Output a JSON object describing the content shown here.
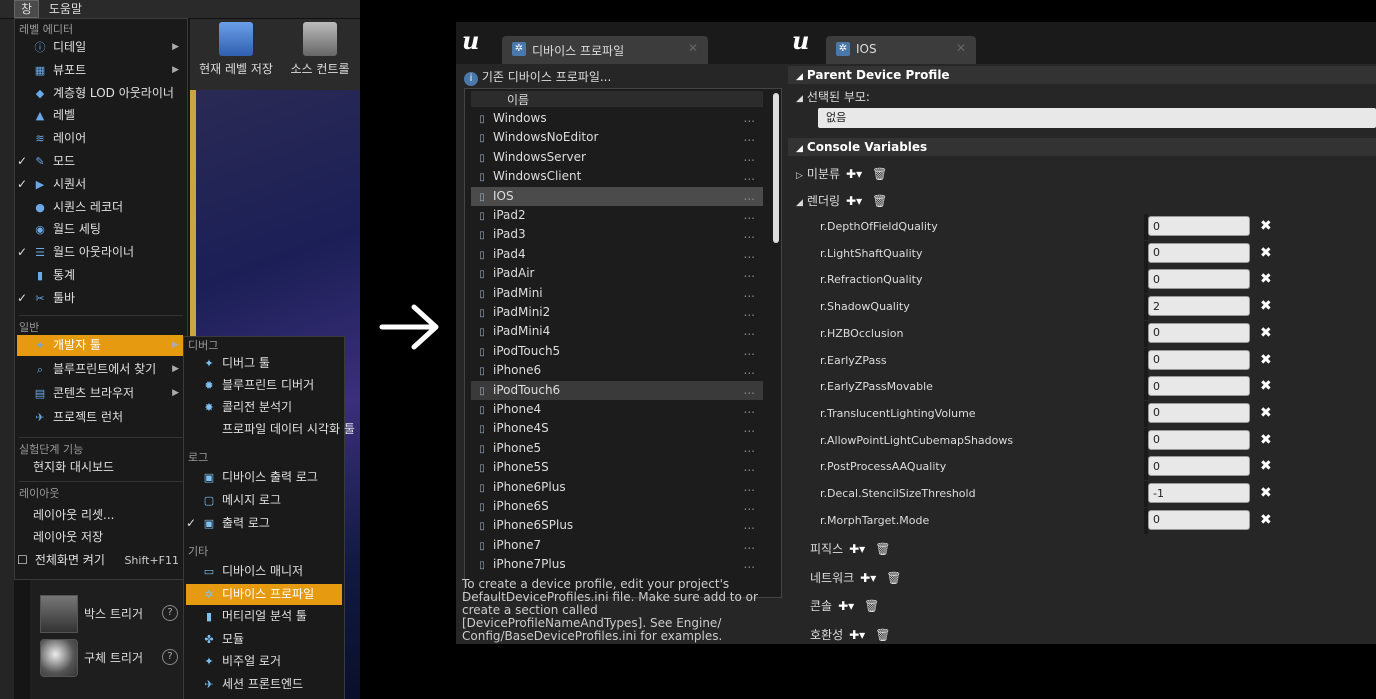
{
  "editor": {
    "menubar": {
      "window": "창",
      "help": "도움말"
    },
    "toolbar": {
      "save": "현재 레벨 저장",
      "source": "소스 컨트롤"
    },
    "place_items": [
      {
        "label": "박스 트리거"
      },
      {
        "label": "구체 트리거"
      }
    ]
  },
  "window_menu": {
    "section_level_editor": "레벨 에디터",
    "items": [
      {
        "label": "디테일",
        "check": "",
        "icon": "ⓘ",
        "arrow": "▶"
      },
      {
        "label": "뷰포트",
        "check": "",
        "icon": "▦",
        "arrow": "▶"
      },
      {
        "label": "계층형 LOD 아웃라이너",
        "check": "",
        "icon": "◆",
        "arrow": ""
      },
      {
        "label": "레벨",
        "check": "",
        "icon": "▲",
        "arrow": ""
      },
      {
        "label": "레이어",
        "check": "",
        "icon": "≋",
        "arrow": ""
      },
      {
        "label": "모드",
        "check": "✓",
        "icon": "✎",
        "arrow": ""
      },
      {
        "label": "시퀀서",
        "check": "✓",
        "icon": "▶",
        "arrow": ""
      },
      {
        "label": "시퀀스 레코더",
        "check": "",
        "icon": "●",
        "arrow": ""
      },
      {
        "label": "월드 세팅",
        "check": "",
        "icon": "◉",
        "arrow": ""
      },
      {
        "label": "월드 아웃라이너",
        "check": "✓",
        "icon": "☰",
        "arrow": ""
      },
      {
        "label": "통계",
        "check": "",
        "icon": "▮",
        "arrow": ""
      },
      {
        "label": "툴바",
        "check": "✓",
        "icon": "✂",
        "arrow": ""
      }
    ],
    "section_general": "일반",
    "general": [
      {
        "label": "개발자 툴",
        "icon": "✦",
        "arrow": "▶"
      },
      {
        "label": "블루프린트에서 찾기",
        "icon": "⌕",
        "arrow": "▶"
      },
      {
        "label": "콘텐츠 브라우저",
        "icon": "▤",
        "arrow": "▶"
      },
      {
        "label": "프로젝트 런처",
        "icon": "✈",
        "arrow": ""
      }
    ],
    "section_experimental": "실험단계 기능",
    "experimental": [
      {
        "label": "현지화 대시보드"
      }
    ],
    "section_layout": "레이아웃",
    "layout": [
      {
        "label": "레이아웃 리셋..."
      },
      {
        "label": "레이아웃 저장"
      }
    ],
    "fullscreen": {
      "label": "전체화면 켜기",
      "shortcut": "Shift+F11"
    }
  },
  "dev_tools_menu": {
    "section_debug": "디버그",
    "debug": [
      {
        "label": "디버그 툴",
        "icon": "✦"
      },
      {
        "label": "블루프린트 디버거",
        "icon": "✹"
      },
      {
        "label": "콜리전 분석기",
        "icon": "✸"
      },
      {
        "label": "프로파일 데이터 시각화 툴",
        "icon": ""
      }
    ],
    "section_log": "로그",
    "log": [
      {
        "label": "디바이스 출력 로그",
        "check": "",
        "icon": "▣"
      },
      {
        "label": "메시지 로그",
        "check": "",
        "icon": "▢"
      },
      {
        "label": "출력 로그",
        "check": "✓",
        "icon": "▣"
      }
    ],
    "section_misc": "기타",
    "misc": [
      {
        "label": "디바이스 매니저",
        "icon": "▭"
      },
      {
        "label": "디바이스 프로파일",
        "icon": "✲"
      },
      {
        "label": "머티리얼 분석 툴",
        "icon": "▮"
      },
      {
        "label": "모듈",
        "icon": "✤"
      },
      {
        "label": "비주얼 로거",
        "icon": "✦"
      },
      {
        "label": "세션 프론트엔드",
        "icon": "✈"
      }
    ]
  },
  "device_profiles": {
    "tab": "디바이스 프로파일",
    "base_link": "기존 디바이스 프로파일...",
    "column_name": "이름",
    "dots": "...",
    "rows": [
      "Windows",
      "WindowsNoEditor",
      "WindowsServer",
      "WindowsClient",
      "IOS",
      "iPad2",
      "iPad3",
      "iPad4",
      "iPadAir",
      "iPadMini",
      "iPadMini2",
      "iPadMini4",
      "iPodTouch5",
      "iPhone6",
      "iPodTouch6",
      "iPhone4",
      "iPhone4S",
      "iPhone5",
      "iPhone5S",
      "iPhone6Plus",
      "iPhone6S",
      "iPhone6SPlus",
      "iPhone7",
      "iPhone7Plus"
    ],
    "info": "To create a device profile, edit your project's DefaultDeviceProfiles.ini file. Make sure add to or create a section called [DeviceProfileNameAndTypes]. See Engine/ Config/BaseDeviceProfiles.ini for examples."
  },
  "ios_panel": {
    "tab": "IOS",
    "parent_section": "Parent Device Profile",
    "selected_parent_label": "선택된 부모:",
    "selected_parent_value": "없음",
    "console_section": "Console Variables",
    "uncategorized": "미분류",
    "rendering": "렌더링",
    "cvars": [
      {
        "name": "r.DepthOfFieldQuality",
        "value": "0"
      },
      {
        "name": "r.LightShaftQuality",
        "value": "0"
      },
      {
        "name": "r.RefractionQuality",
        "value": "0"
      },
      {
        "name": "r.ShadowQuality",
        "value": "2"
      },
      {
        "name": "r.HZBOcclusion",
        "value": "0"
      },
      {
        "name": "r.EarlyZPass",
        "value": "0"
      },
      {
        "name": "r.EarlyZPassMovable",
        "value": "0"
      },
      {
        "name": "r.TranslucentLightingVolume",
        "value": "0"
      },
      {
        "name": "r.AllowPointLightCubemapShadows",
        "value": "0"
      },
      {
        "name": "r.PostProcessAAQuality",
        "value": "0"
      },
      {
        "name": "r.Decal.StencilSizeThreshold",
        "value": "-1"
      },
      {
        "name": "r.MorphTarget.Mode",
        "value": "0"
      }
    ],
    "other_categories": [
      "피직스",
      "네트워크",
      "콘솔",
      "호환성"
    ]
  },
  "colors": {
    "accent": "#e69a10",
    "panel": "#262626",
    "menu": "#1a1a1a"
  }
}
